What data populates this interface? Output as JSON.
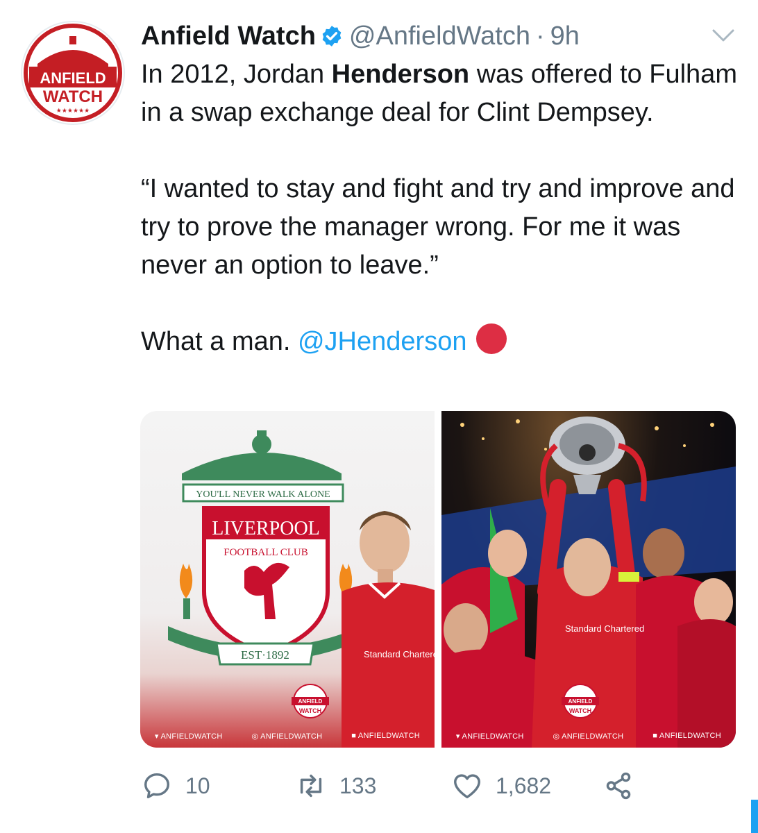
{
  "account": {
    "avatar_text_top": "ANFIELD",
    "avatar_text_bottom": "WATCH",
    "display_name": "Anfield Watch",
    "handle": "@AnfieldWatch",
    "separator": "·",
    "time": "9h"
  },
  "tweet": {
    "p1_before": "In 2012, Jordan ",
    "p1_bold": "Henderson",
    "p1_after": " was offered to Fulham in a swap exchange deal for Clint Dempsey.",
    "p2": "“I wanted to stay and fight and try and improve and try to prove the manager wrong. For me it was never an option to leave.”",
    "p3_before": "What a man. ",
    "p3_mention": "@JHenderson"
  },
  "media": {
    "left": {
      "motto": "YOU'LL NEVER WALK ALONE",
      "club_name": "LIVERPOOL",
      "club_sub": "FOOTBALL CLUB",
      "est": "EST·1892",
      "sponsor": "Standard Chartered",
      "watermark_top": "ANFIELD",
      "watermark_bottom": "WATCH"
    },
    "right": {
      "sponsor": "Standard Chartered",
      "watermark_top": "ANFIELD",
      "watermark_bottom": "WATCH"
    },
    "social": {
      "twitter": "ANFIELDWATCH",
      "instagram": "ANFIELDWATCH",
      "facebook": "ANFIELDWATCH"
    }
  },
  "actions": {
    "replies": "10",
    "retweets": "133",
    "likes": "1,682"
  },
  "colors": {
    "link": "#1da1f2",
    "muted": "#657786",
    "liverpool_red": "#c8102e",
    "emoji_red": "#dd2e44"
  }
}
